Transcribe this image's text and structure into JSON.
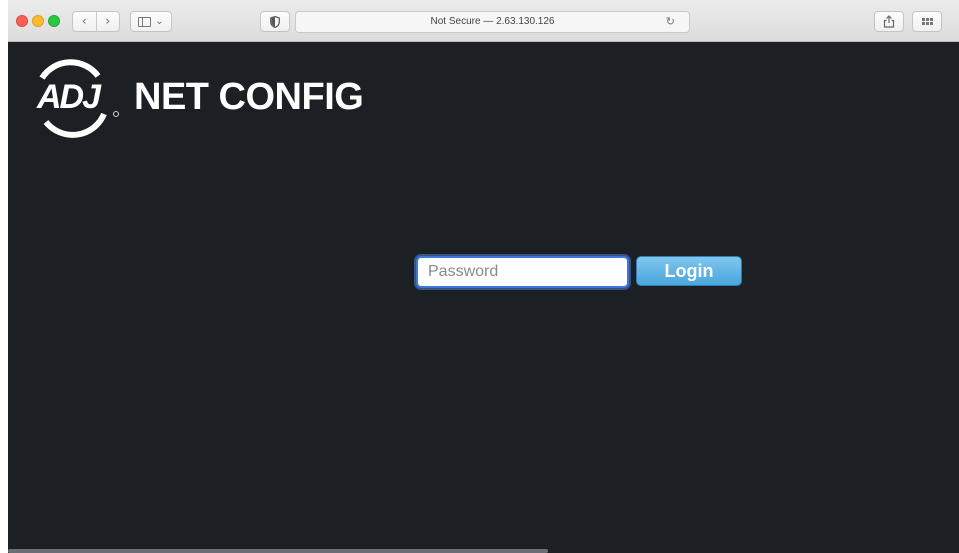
{
  "browser": {
    "address_text": "Not Secure — 2.63.130.126",
    "back_glyph": "‹",
    "forward_glyph": "›",
    "sidebar_chevron": "⌄",
    "reload_glyph": "↻",
    "share_glyph": "⇪",
    "icons": [
      "close-dot",
      "minimize-dot",
      "zoom-dot",
      "back-icon",
      "forward-icon",
      "sidebar-icon",
      "shield-icon",
      "reload-icon",
      "share-icon",
      "tabs-overview-icon"
    ],
    "traffic_colors": {
      "close": "#fc5f57",
      "minimize": "#fdbc2e",
      "zoom": "#28c840"
    }
  },
  "page": {
    "brand_logo_text": "ADJ",
    "title": "NET CONFIG",
    "background": "#1c1f24"
  },
  "login": {
    "password_placeholder": "Password",
    "password_value": "",
    "button_label": "Login",
    "button_color": "#4aa6dc"
  }
}
